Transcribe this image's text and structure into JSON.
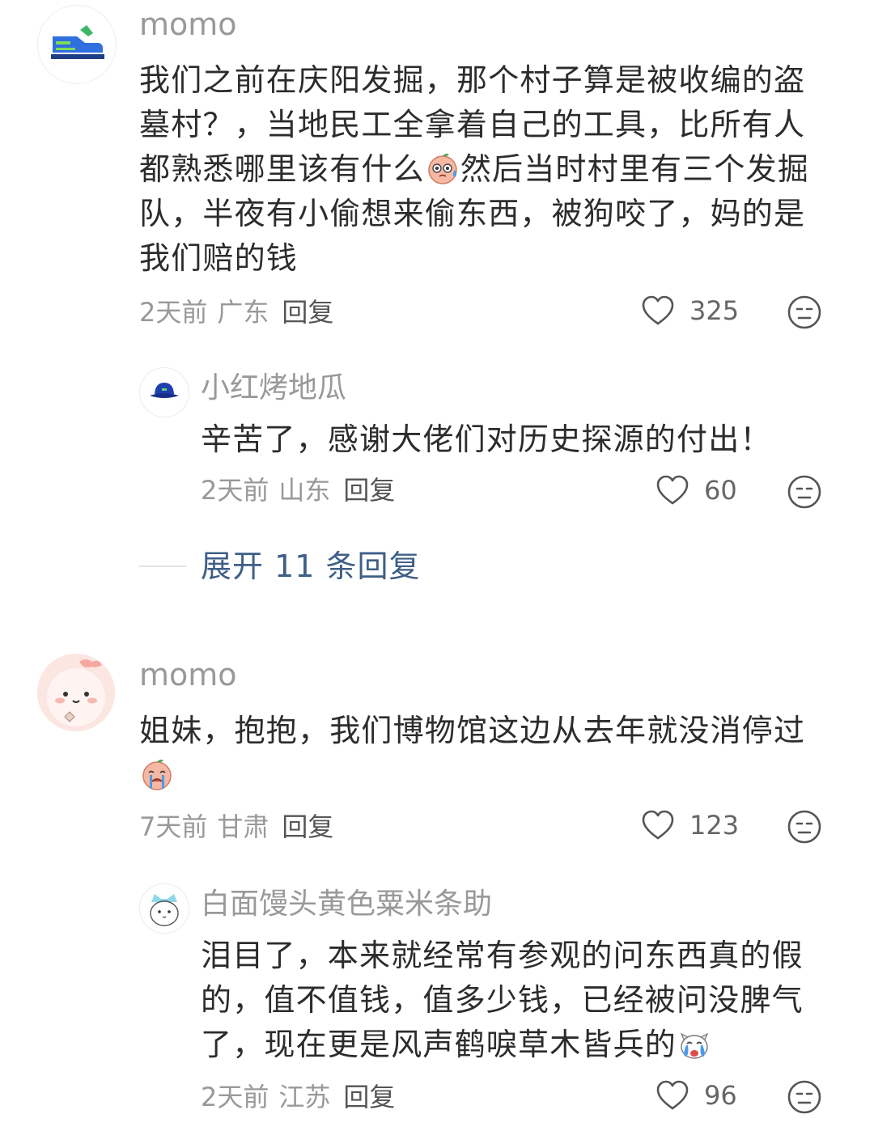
{
  "comments": [
    {
      "user": "momo",
      "text_before": "我们之前在庆阳发掘，那个村子算是被收编的盗墓村？，当地民工全拿着自己的工具，比所有人都熟悉哪里该有什么",
      "emoji": "sweat-peach-emoji",
      "text_after": "然后当时村里有三个发掘队，半夜有小偷想来偷东西，被狗咬了，妈的是我们赔的钱",
      "time": "2天前",
      "location": "广东",
      "reply_label": "回复",
      "likes": "325",
      "reply": {
        "user": "小红烤地瓜",
        "text": "辛苦了，感谢大佬们对历史探源的付出！",
        "time": "2天前",
        "location": "山东",
        "reply_label": "回复",
        "likes": "60"
      },
      "expand_label": "展开 11 条回复"
    },
    {
      "user": "momo",
      "text_before": "姐妹，抱抱，我们博物馆这边从去年就没消停过",
      "emoji": "crying-peach-emoji",
      "text_after": "",
      "time": "7天前",
      "location": "甘肃",
      "reply_label": "回复",
      "likes": "123",
      "reply": {
        "user": "白面馒头黄色粟米条助",
        "text": "泪目了，本来就经常有参观的问东西真的假的，值不值钱，值多少钱，已经被问没脾气了，现在更是风声鹤唳草木皆兵的",
        "emoji": "crying-dog-emoji",
        "time": "2天前",
        "location": "江苏",
        "reply_label": "回复",
        "likes": "96"
      }
    }
  ],
  "colors": {
    "text": "#2c2c2c",
    "meta": "#999999",
    "link": "#3e5f86",
    "icon": "#555555"
  }
}
